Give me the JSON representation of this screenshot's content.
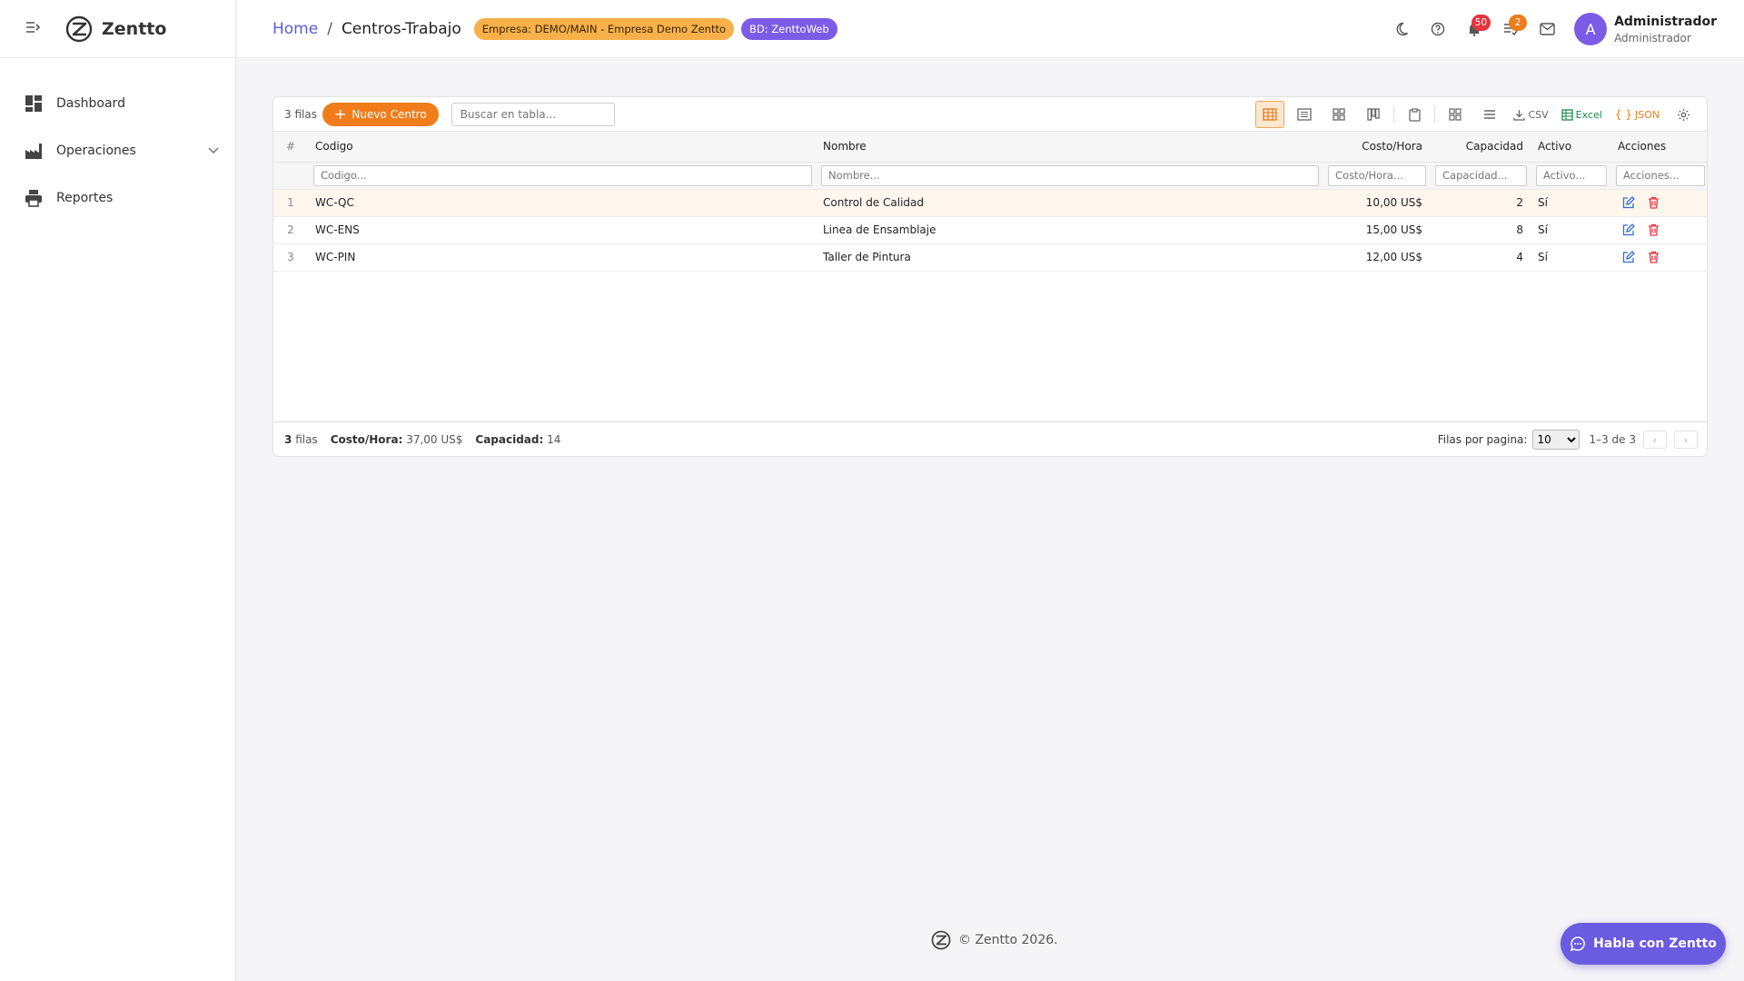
{
  "brand": {
    "name": "Zentto"
  },
  "sidebar": {
    "items": [
      {
        "label": "Dashboard",
        "icon": "dashboard-icon"
      },
      {
        "label": "Operaciones",
        "icon": "factory-icon",
        "expandable": true
      },
      {
        "label": "Reportes",
        "icon": "printer-icon"
      }
    ]
  },
  "header": {
    "breadcrumb_home": "Home",
    "breadcrumb_sep": "/",
    "breadcrumb_current": "Centros-Trabajo",
    "empresa_pill": "Empresa: DEMO/MAIN - Empresa Demo Zentto",
    "db_pill": "BD: ZenttoWeb",
    "notifications_count": "50",
    "tasks_count": "2",
    "avatar_letter": "A",
    "user_name": "Administrador",
    "user_role": "Administrador"
  },
  "toolbar": {
    "row_count": "3 filas",
    "new_button": "Nuevo Centro",
    "new_button_plus": "+",
    "search_placeholder": "Buscar en tabla...",
    "csv_label": "CSV",
    "excel_label": "Excel",
    "json_label": "JSON",
    "json_glyph": "{ }"
  },
  "table": {
    "headers": {
      "num": "#",
      "codigo": "Codigo",
      "nombre": "Nombre",
      "costo": "Costo/Hora",
      "capacidad": "Capacidad",
      "activo": "Activo",
      "acciones": "Acciones"
    },
    "filters": {
      "codigo": "Codigo...",
      "nombre": "Nombre...",
      "costo": "Costo/Hora...",
      "capacidad": "Capacidad...",
      "activo": "Activo...",
      "acciones": "Acciones..."
    },
    "rows": [
      {
        "num": "1",
        "codigo": "WC-QC",
        "nombre": "Control de Calidad",
        "costo": "10,00 US$",
        "capacidad": "2",
        "activo": "Sí"
      },
      {
        "num": "2",
        "codigo": "WC-ENS",
        "nombre": "Linea de Ensamblaje",
        "costo": "15,00 US$",
        "capacidad": "8",
        "activo": "Sí"
      },
      {
        "num": "3",
        "codigo": "WC-PIN",
        "nombre": "Taller de Pintura",
        "costo": "12,00 US$",
        "capacidad": "4",
        "activo": "Sí"
      }
    ]
  },
  "footer": {
    "rows_num": "3",
    "rows_word": "filas",
    "costo_label": "Costo/Hora:",
    "costo_value": "37,00 US$",
    "capacidad_label": "Capacidad:",
    "capacidad_value": "14",
    "per_page_label": "Filas por pagina:",
    "per_page_value": "10",
    "range": "1–3 de 3",
    "prev": "‹",
    "next": "›"
  },
  "page_footer": {
    "copyright": "© Zentto 2026."
  },
  "chat": {
    "label": "Habla con Zentto"
  },
  "colors": {
    "accent_orange": "#f07c1b",
    "accent_purple": "#7b5ce6",
    "link_blue": "#5b5bd6",
    "danger_red": "#e5333f"
  }
}
